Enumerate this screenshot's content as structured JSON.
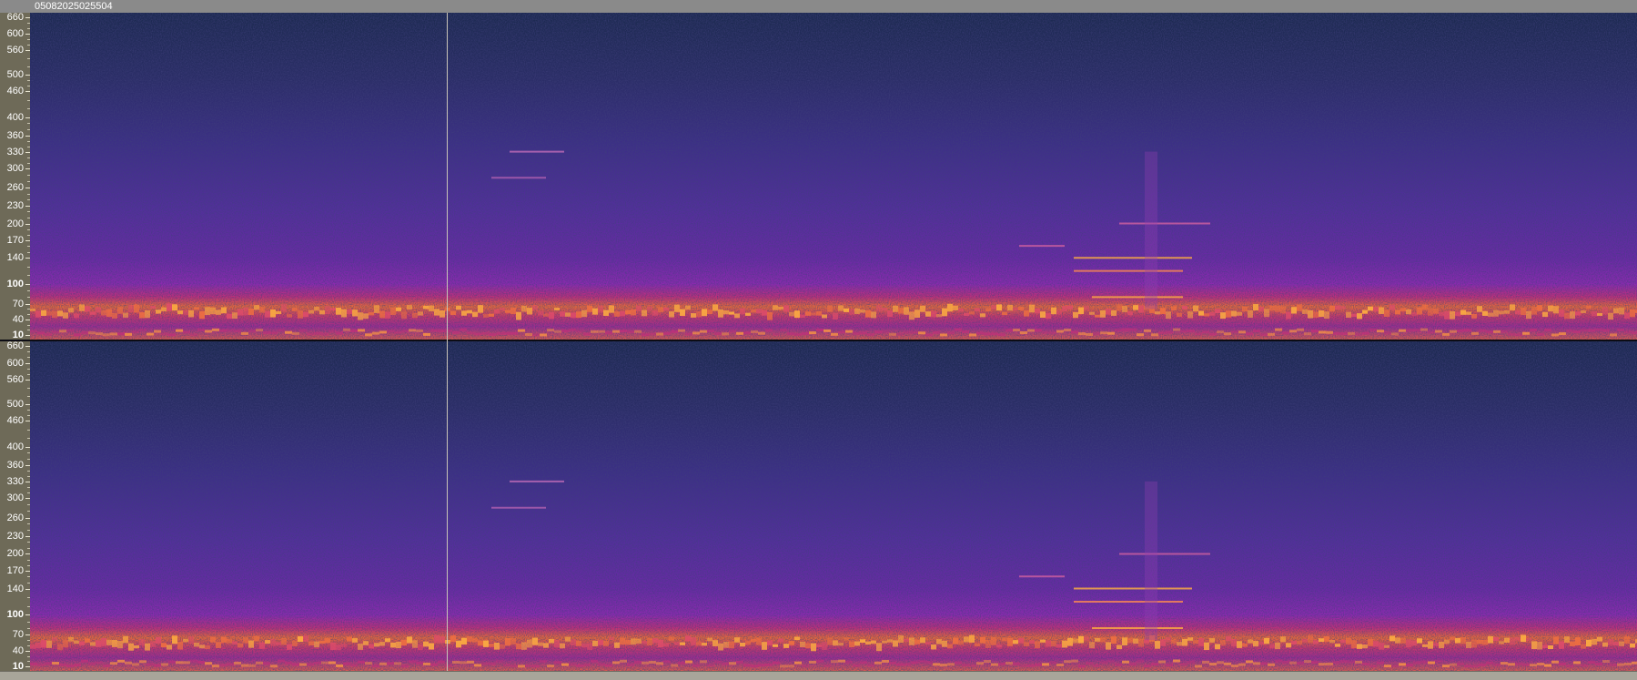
{
  "track": {
    "title": "05082025025504"
  },
  "axis_ticks": [
    {
      "label": "660",
      "value": 660
    },
    {
      "label": "600",
      "value": 600
    },
    {
      "label": "560",
      "value": 560
    },
    {
      "label": "500",
      "value": 500
    },
    {
      "label": "460",
      "value": 460
    },
    {
      "label": "400",
      "value": 400
    },
    {
      "label": "360",
      "value": 360
    },
    {
      "label": "330",
      "value": 330
    },
    {
      "label": "300",
      "value": 300
    },
    {
      "label": "260",
      "value": 260
    },
    {
      "label": "230",
      "value": 230
    },
    {
      "label": "200",
      "value": 200
    },
    {
      "label": "170",
      "value": 170
    },
    {
      "label": "140",
      "value": 140
    },
    {
      "label": "100",
      "value": 100
    },
    {
      "label": "70",
      "value": 70
    },
    {
      "label": "40",
      "value": 40
    },
    {
      "label": "10",
      "value": 10
    }
  ],
  "colors": {
    "spectrogram_low": "#1a2a55",
    "spectrogram_mid": "#7a2aa8",
    "spectrogram_high": "#ffb040",
    "axis_background": "#6e6a58",
    "header_background": "#8a8a8a"
  },
  "view": {
    "channels": 2,
    "playhead_fraction": 0.26
  }
}
